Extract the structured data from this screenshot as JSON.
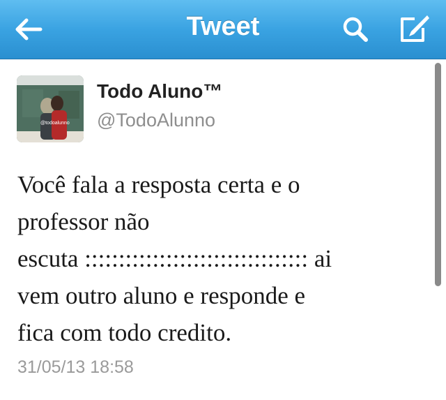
{
  "navbar": {
    "title": "Tweet",
    "back_icon": "back-arrow-icon",
    "search_icon": "search-icon",
    "compose_icon": "compose-icon",
    "background_color": "#3aa3e2"
  },
  "tweet": {
    "display_name": "Todo Aluno™",
    "handle": "@TodoAlunno",
    "avatar_watermark": "@todoalunno",
    "text_lines": [
      "Você fala a resposta certa e o",
      "professor não",
      "escuta ::::::::::::::::::::::::::::::::: ai",
      "vem outro aluno e responde e",
      "fica com todo credito."
    ],
    "timestamp": "31/05/13 18:58"
  }
}
